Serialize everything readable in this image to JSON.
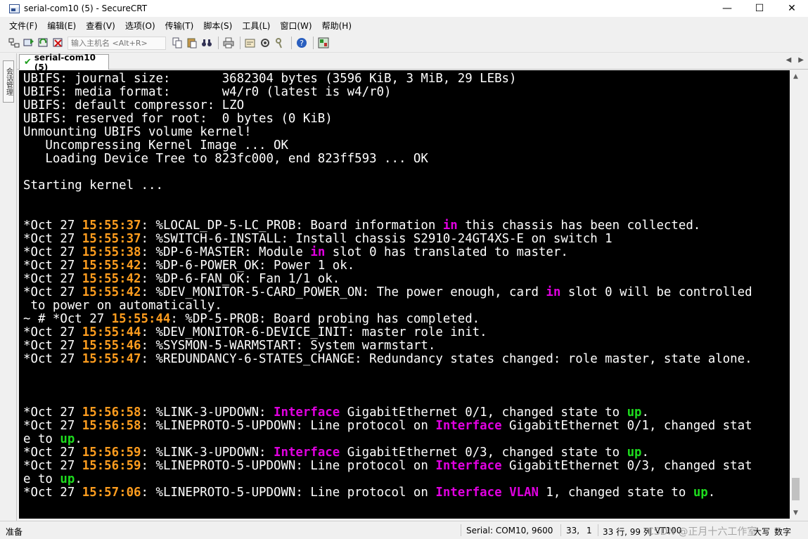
{
  "window": {
    "title": "serial-com10 (5) - SecureCRT",
    "controls": {
      "minimize": "—",
      "maximize": "☐",
      "close": "✕"
    }
  },
  "menu": [
    "文件(F)",
    "编辑(E)",
    "查看(V)",
    "选项(O)",
    "传输(T)",
    "脚本(S)",
    "工具(L)",
    "窗口(W)",
    "帮助(H)"
  ],
  "toolbar": {
    "host_placeholder": "输入主机名 <Alt+R>",
    "icons": [
      "connect-icon",
      "quick-connect-icon",
      "reconnect-icon",
      "disconnect-icon",
      "copy-icon",
      "paste-icon",
      "find-icon",
      "print-icon",
      "settings-icon",
      "options-icon",
      "keymap-icon",
      "help-icon",
      "map-icon"
    ]
  },
  "side_panel": {
    "label": "会话管理"
  },
  "tab": {
    "label": "serial-com10 (5)"
  },
  "colors": {
    "terminal_bg": "#000000",
    "terminal_fg": "#ffffff",
    "timestamp": "#ff9d1e",
    "keyword": "#e000e0",
    "state_up": "#1edc1e"
  },
  "terminal": {
    "lines": [
      [
        {
          "t": "UBIFS: journal size:       3682304 bytes (3596 KiB, 3 MiB, 29 LEBs)"
        }
      ],
      [
        {
          "t": "UBIFS: media format:       w4/r0 (latest is w4/r0)"
        }
      ],
      [
        {
          "t": "UBIFS: default compressor: LZO"
        }
      ],
      [
        {
          "t": "UBIFS: reserved for root:  0 bytes (0 KiB)"
        }
      ],
      [
        {
          "t": "Unmounting UBIFS volume kernel!"
        }
      ],
      [
        {
          "t": "   Uncompressing Kernel Image ... OK"
        }
      ],
      [
        {
          "t": "   Loading Device Tree to 823fc000, end 823ff593 ... OK"
        }
      ],
      [
        {
          "t": ""
        }
      ],
      [
        {
          "t": "Starting kernel ..."
        }
      ],
      [
        {
          "t": ""
        }
      ],
      [
        {
          "t": ""
        }
      ],
      [
        {
          "t": "*Oct 27 "
        },
        {
          "t": "15:55:37",
          "c": "ts"
        },
        {
          "t": ": %LOCAL_DP-5-LC_PROB: Board information "
        },
        {
          "t": "in",
          "c": "kw"
        },
        {
          "t": " this chassis has been collected."
        }
      ],
      [
        {
          "t": "*Oct 27 "
        },
        {
          "t": "15:55:37",
          "c": "ts"
        },
        {
          "t": ": %SWITCH-6-INSTALL: Install chassis S2910-24GT4XS-E on switch 1"
        }
      ],
      [
        {
          "t": "*Oct 27 "
        },
        {
          "t": "15:55:38",
          "c": "ts"
        },
        {
          "t": ": %DP-6-MASTER: Module "
        },
        {
          "t": "in",
          "c": "kw"
        },
        {
          "t": " slot 0 has translated to master."
        }
      ],
      [
        {
          "t": "*Oct 27 "
        },
        {
          "t": "15:55:42",
          "c": "ts"
        },
        {
          "t": ": %DP-6-POWER_OK: Power 1 ok."
        }
      ],
      [
        {
          "t": "*Oct 27 "
        },
        {
          "t": "15:55:42",
          "c": "ts"
        },
        {
          "t": ": %DP-6-FAN_OK: Fan 1/1 ok."
        }
      ],
      [
        {
          "t": "*Oct 27 "
        },
        {
          "t": "15:55:42",
          "c": "ts"
        },
        {
          "t": ": %DEV_MONITOR-5-CARD_POWER_ON: The power enough, card "
        },
        {
          "t": "in",
          "c": "kw"
        },
        {
          "t": " slot 0 will be controlled"
        }
      ],
      [
        {
          "t": " to power on automatically."
        }
      ],
      [
        {
          "t": "~ # *Oct 27 "
        },
        {
          "t": "15:55:44",
          "c": "ts"
        },
        {
          "t": ": %DP-5-PROB: Board probing has completed."
        }
      ],
      [
        {
          "t": "*Oct 27 "
        },
        {
          "t": "15:55:44",
          "c": "ts"
        },
        {
          "t": ": %DEV_MONITOR-6-DEVICE_INIT: master role init."
        }
      ],
      [
        {
          "t": "*Oct 27 "
        },
        {
          "t": "15:55:46",
          "c": "ts"
        },
        {
          "t": ": %SYSMON-5-WARMSTART: System warmstart."
        }
      ],
      [
        {
          "t": "*Oct 27 "
        },
        {
          "t": "15:55:47",
          "c": "ts"
        },
        {
          "t": ": %REDUNDANCY-6-STATES_CHANGE: Redundancy states changed: role master, state alone."
        }
      ],
      [
        {
          "t": ""
        }
      ],
      [
        {
          "t": ""
        }
      ],
      [
        {
          "t": ""
        }
      ],
      [
        {
          "t": "*Oct 27 "
        },
        {
          "t": "15:56:58",
          "c": "ts"
        },
        {
          "t": ": %LINK-3-UPDOWN: "
        },
        {
          "t": "Interface",
          "c": "kw"
        },
        {
          "t": " GigabitEthernet 0/1, changed state to "
        },
        {
          "t": "up",
          "c": "up"
        },
        {
          "t": "."
        }
      ],
      [
        {
          "t": "*Oct 27 "
        },
        {
          "t": "15:56:58",
          "c": "ts"
        },
        {
          "t": ": %LINEPROTO-5-UPDOWN: Line protocol on "
        },
        {
          "t": "Interface",
          "c": "kw"
        },
        {
          "t": " GigabitEthernet 0/1, changed stat"
        }
      ],
      [
        {
          "t": "e to "
        },
        {
          "t": "up",
          "c": "up"
        },
        {
          "t": "."
        }
      ],
      [
        {
          "t": "*Oct 27 "
        },
        {
          "t": "15:56:59",
          "c": "ts"
        },
        {
          "t": ": %LINK-3-UPDOWN: "
        },
        {
          "t": "Interface",
          "c": "kw"
        },
        {
          "t": " GigabitEthernet 0/3, changed state to "
        },
        {
          "t": "up",
          "c": "up"
        },
        {
          "t": "."
        }
      ],
      [
        {
          "t": "*Oct 27 "
        },
        {
          "t": "15:56:59",
          "c": "ts"
        },
        {
          "t": ": %LINEPROTO-5-UPDOWN: Line protocol on "
        },
        {
          "t": "Interface",
          "c": "kw"
        },
        {
          "t": " GigabitEthernet 0/3, changed stat"
        }
      ],
      [
        {
          "t": "e to "
        },
        {
          "t": "up",
          "c": "up"
        },
        {
          "t": "."
        }
      ],
      [
        {
          "t": "*Oct 27 "
        },
        {
          "t": "15:57:06",
          "c": "ts"
        },
        {
          "t": ": %LINEPROTO-5-UPDOWN: Line protocol on "
        },
        {
          "t": "Interface",
          "c": "kw"
        },
        {
          "t": " "
        },
        {
          "t": "VLAN",
          "c": "kw"
        },
        {
          "t": " 1, changed state to "
        },
        {
          "t": "up",
          "c": "up"
        },
        {
          "t": "."
        }
      ]
    ]
  },
  "status": {
    "ready": "准备",
    "connection": "Serial: COM10, 9600",
    "cursor_row": "33,",
    "cursor_col": "1",
    "size": "33 行, 99 列",
    "emulation": "VT100",
    "caps": "大写",
    "num": "数字"
  },
  "watermark": "CSDN @正月十六工作室"
}
